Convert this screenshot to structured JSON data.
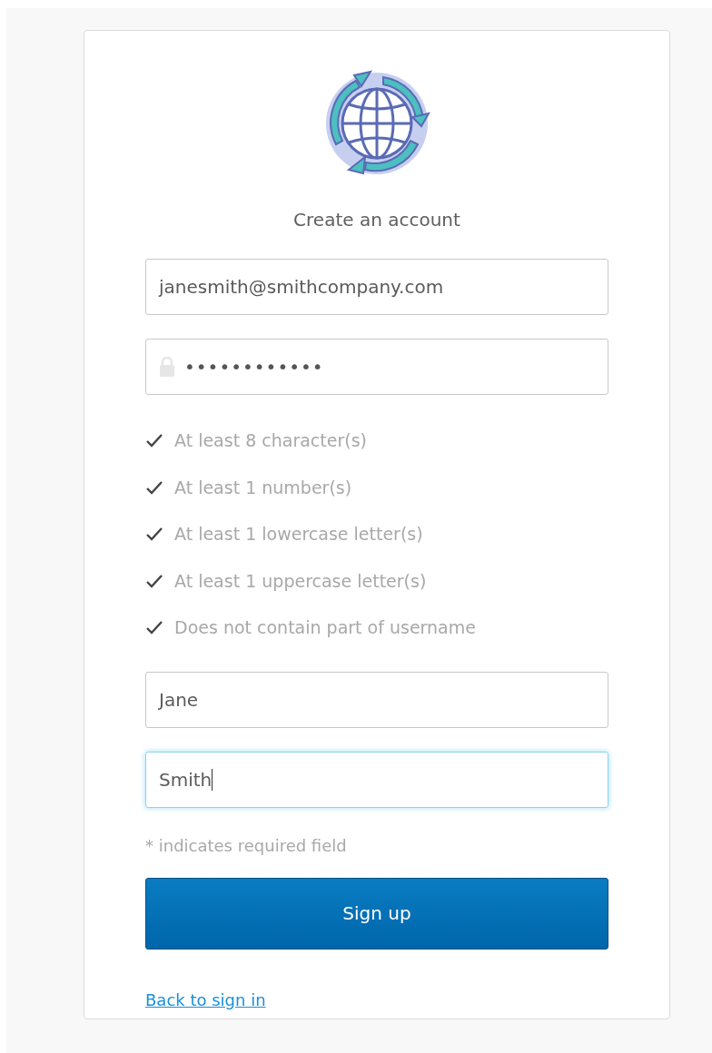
{
  "title": "Create an account",
  "fields": [
    {
      "kind": "text",
      "value": "janesmith@smithcompany.com",
      "focused": false
    },
    {
      "kind": "password",
      "value": "••••••••••••",
      "focused": false
    }
  ],
  "requirements": [
    {
      "label": "At least 8 character(s)",
      "met": true
    },
    {
      "label": "At least 1 number(s)",
      "met": true
    },
    {
      "label": "At least 1 lowercase letter(s)",
      "met": true
    },
    {
      "label": "At least 1 uppercase letter(s)",
      "met": true
    },
    {
      "label": "Does not contain part of username",
      "met": true
    }
  ],
  "name_fields": [
    {
      "kind": "text",
      "value": "Jane",
      "focused": false
    },
    {
      "kind": "text",
      "value": "Smith",
      "focused": true
    }
  ],
  "required_note": "* indicates required field",
  "submit_button": "Sign up",
  "back_link": "Back to sign in"
}
